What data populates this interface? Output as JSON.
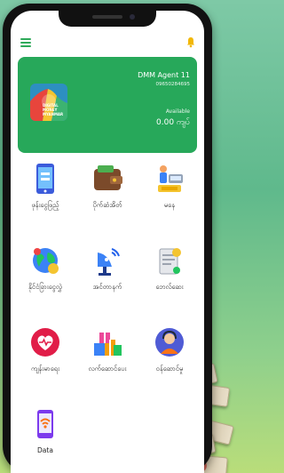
{
  "header": {
    "menu_icon": "hamburger-icon",
    "notification_icon": "bell-icon"
  },
  "card": {
    "agent_name": "DMM Agent 11",
    "agent_phone": "09650284695",
    "available_label": "Available",
    "available_amount": "0.00 ကျပ်",
    "logo_text": "DIGITAL MONEY MYANMAR",
    "colors": {
      "card_bg": "#27a85a",
      "accent": "#2faa5a"
    }
  },
  "services": [
    {
      "label": "ဖုန်းငွေဖြည့်",
      "icon": "phone-topup-icon"
    },
    {
      "label": "ပိုက်ဆံအိတ်",
      "icon": "wallet-icon"
    },
    {
      "label": "မနေ",
      "icon": "money-transfer-icon"
    },
    {
      "label": "နိုင်ငံခြားငွေလွှဲ",
      "icon": "globe-transfer-icon"
    },
    {
      "label": "အင်တာနက်",
      "icon": "satellite-icon"
    },
    {
      "label": "ဘေလ်ဆေး",
      "icon": "bill-payment-icon"
    },
    {
      "label": "ကျန်းမာရေး",
      "icon": "health-icon"
    },
    {
      "label": "လက်ဆောင်ပေး",
      "icon": "gift-boxes-icon"
    },
    {
      "label": "ဝန်ဆောင်မှု",
      "icon": "support-agent-icon"
    },
    {
      "label": "Data",
      "icon": "data-icon"
    }
  ]
}
